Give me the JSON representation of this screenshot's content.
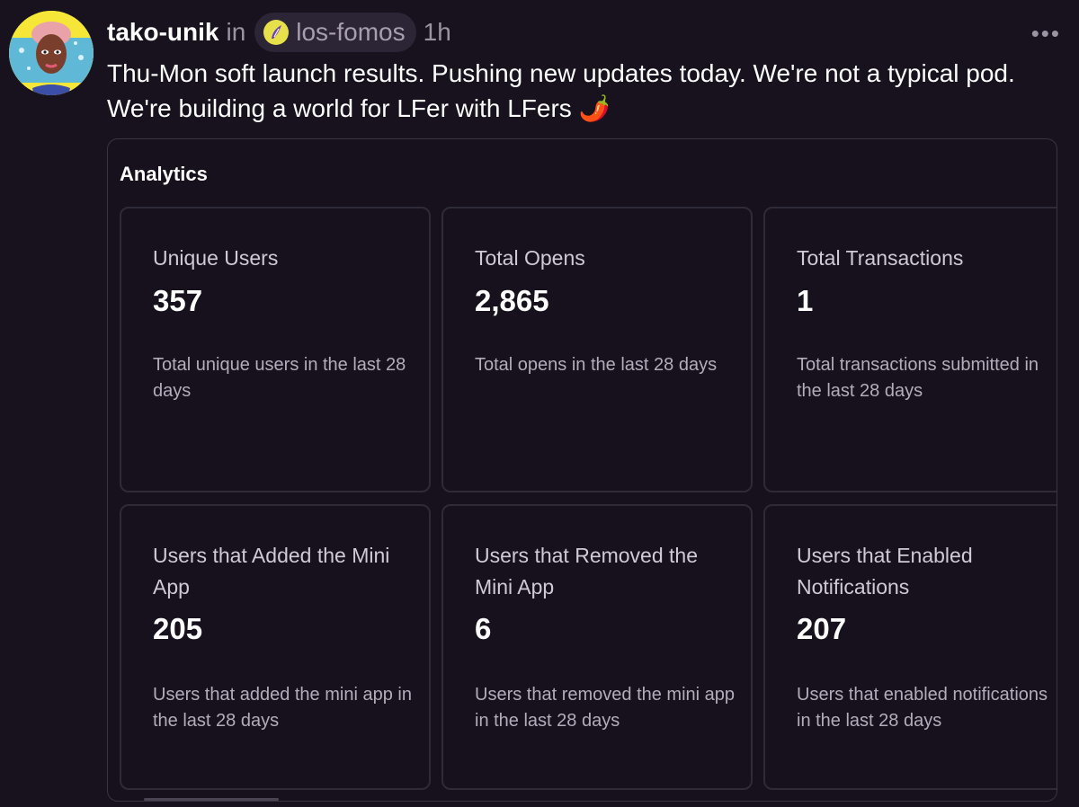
{
  "post": {
    "author": "tako-unik",
    "in_word": "in",
    "channel": "los-fomos",
    "time": "1h",
    "more_label": "•••",
    "text": "Thu-Mon soft launch results. Pushing new updates today. We're not a typical pod. We're building a world for LFer with LFers 🌶️"
  },
  "embed": {
    "title": "Analytics",
    "cards": [
      {
        "label": "Unique Users",
        "value": "357",
        "desc": "Total unique users in the last 28 days"
      },
      {
        "label": "Total Opens",
        "value": "2,865",
        "desc": "Total opens in the last 28 days"
      },
      {
        "label": "Total Transactions",
        "value": "1",
        "desc": "Total transactions submitted in the last 28 days"
      },
      {
        "label": "Users that Added the Mini App",
        "value": "205",
        "desc": "Users that added the mini app in the last 28 days"
      },
      {
        "label": "Users that Removed the Mini App",
        "value": "6",
        "desc": "Users that removed the mini app in the last 28 days"
      },
      {
        "label": "Users that Enabled Notifications",
        "value": "207",
        "desc": "Users that enabled notifications in the last 28 days"
      }
    ]
  },
  "colors": {
    "background": "#17121d",
    "card_border": "#2f2a37",
    "muted_text": "#9a94a2",
    "avatar_bg": "#f6e637"
  },
  "icons": {
    "channel": "los-fomos-channel-icon",
    "more": "more-options-icon"
  }
}
